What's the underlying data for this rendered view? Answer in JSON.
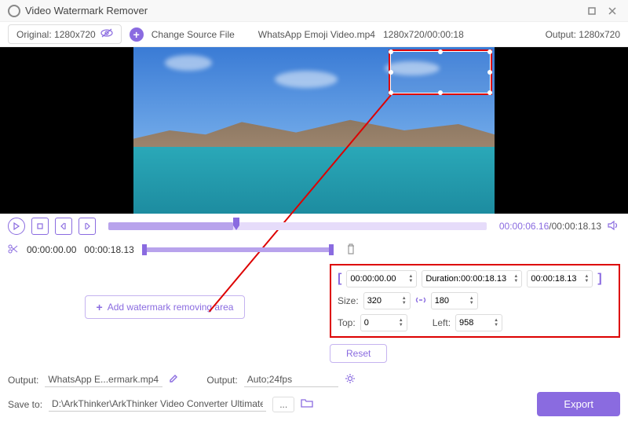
{
  "app": {
    "title": "Video Watermark Remover"
  },
  "topbar": {
    "original_label": "Original: 1280x720",
    "change_source": "Change Source File",
    "filename": "WhatsApp Emoji Video.mp4",
    "resolution_time": "1280x720/00:00:18",
    "output_label": "Output: 1280x720"
  },
  "timeline": {
    "current": "00:00:06.16",
    "total": "/00:00:18.13",
    "progress_pct": 33
  },
  "segment": {
    "start": "00:00:00.00",
    "end": "00:00:18.13"
  },
  "params": {
    "start_time": "00:00:00.00",
    "duration_label": "Duration:00:00:18.13",
    "end_time": "00:00:18.13",
    "size_label": "Size:",
    "width": "320",
    "height": "180",
    "top_label": "Top:",
    "top": "0",
    "left_label": "Left:",
    "left": "958"
  },
  "buttons": {
    "add_area": "Add watermark removing area",
    "reset": "Reset",
    "export": "Export"
  },
  "output": {
    "label1": "Output:",
    "filename": "WhatsApp E...ermark.mp4",
    "label2": "Output:",
    "format": "Auto;24fps",
    "saveto_label": "Save to:",
    "saveto_path": "D:\\ArkThinker\\ArkThinker Video Converter Ultimate\\Video Watermark Remover"
  }
}
